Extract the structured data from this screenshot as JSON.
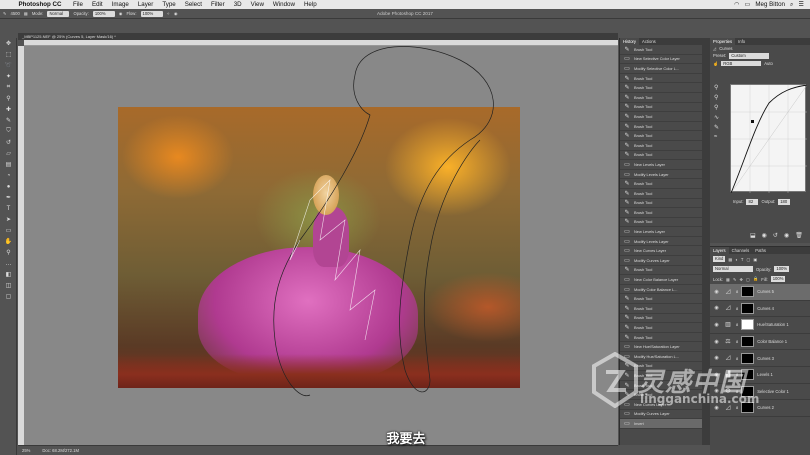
{
  "menubar": {
    "app": "Photoshop CC",
    "items": [
      "File",
      "Edit",
      "Image",
      "Layer",
      "Type",
      "Select",
      "Filter",
      "3D",
      "View",
      "Window",
      "Help"
    ],
    "user": "Meg Bitton"
  },
  "options": {
    "window_title": "Adobe Photoshop CC 2017",
    "mode_label": "Mode:",
    "mode_value": "Normal",
    "opacity_label": "Opacity:",
    "opacity_value": "100%",
    "flow_label": "Flow:",
    "flow_value": "100%",
    "brush_size": "4500"
  },
  "document": {
    "tab_title": "_MBP1125.NEF @ 25% (Curves 5, Layer Mask/16) *"
  },
  "history": {
    "tabs": [
      "History",
      "Actions"
    ],
    "items": [
      "Brush Tool",
      "New Selective Color Layer",
      "Modify Selective Color L...",
      "Brush Tool",
      "Brush Tool",
      "Brush Tool",
      "Brush Tool",
      "Brush Tool",
      "Brush Tool",
      "Brush Tool",
      "Brush Tool",
      "Brush Tool",
      "New Levels Layer",
      "Modify Levels Layer",
      "Brush Tool",
      "Brush Tool",
      "Brush Tool",
      "Brush Tool",
      "Brush Tool",
      "New Levels Layer",
      "Modify Levels Layer",
      "New Curves Layer",
      "Modify Curves Layer",
      "Brush Tool",
      "New Color Balance Layer",
      "Modify Color Balance L...",
      "Brush Tool",
      "Brush Tool",
      "Brush Tool",
      "Brush Tool",
      "Brush Tool",
      "New Hue/Saturation Layer",
      "Modify Hue/Saturation L...",
      "Brush Tool",
      "Brush Tool",
      "Brush Tool",
      "Brush Tool",
      "New Curves Layer",
      "Modify Curves Layer",
      "Invert"
    ]
  },
  "properties": {
    "tabs": [
      "Properties",
      "Info"
    ],
    "panel_title": "Curves",
    "preset_label": "Preset:",
    "preset_value": "Custom",
    "channel_value": "RGB",
    "auto_label": "Auto",
    "input_label": "Input:",
    "input_value": "82",
    "output_label": "Output:",
    "output_value": "180"
  },
  "layers": {
    "tabs": [
      "Layers",
      "Channels",
      "Paths"
    ],
    "kind_value": "Kind",
    "blend_value": "Normal",
    "opacity_label": "Opacity:",
    "opacity_value": "100%",
    "lock_label": "Lock:",
    "fill_label": "Fill:",
    "fill_value": "100%",
    "items": [
      {
        "name": "Curves 5",
        "icon": "curves-icon",
        "mask": "black",
        "selected": true
      },
      {
        "name": "Curves 4",
        "icon": "curves-icon",
        "mask": "black",
        "selected": false
      },
      {
        "name": "Hue/Saturation 1",
        "icon": "hue-saturation-icon",
        "mask": "white",
        "selected": false
      },
      {
        "name": "Color Balance 1",
        "icon": "color-balance-icon",
        "mask": "black",
        "selected": false
      },
      {
        "name": "Curves 3",
        "icon": "curves-icon",
        "mask": "black",
        "selected": false
      },
      {
        "name": "Levels 1",
        "icon": "levels-icon",
        "mask": "black",
        "selected": false
      },
      {
        "name": "Selective Color 1",
        "icon": "selective-color-icon",
        "mask": "black",
        "selected": false
      },
      {
        "name": "Curves 2",
        "icon": "curves-icon",
        "mask": "black",
        "selected": false
      }
    ]
  },
  "status": {
    "zoom": "25%",
    "doc_size": "Doc: 68.2M/272.1M"
  },
  "subtitle": "我要去",
  "watermark": {
    "text": "灵感中国",
    "url": "lingganchina.com"
  },
  "colors": {
    "ui_dark": "#535353",
    "panel": "#4a4a4a",
    "selected_row": "#6c6c6c"
  }
}
